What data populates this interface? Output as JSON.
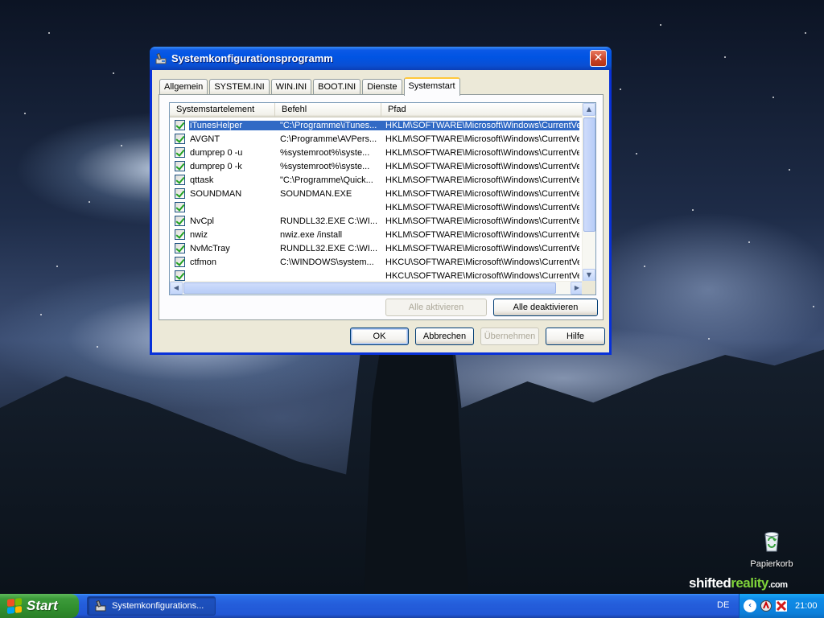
{
  "window": {
    "title": "Systemkonfigurationsprogramm",
    "close_label": "✕",
    "tabs": [
      {
        "label": "Allgemein"
      },
      {
        "label": "SYSTEM.INI"
      },
      {
        "label": "WIN.INI"
      },
      {
        "label": "BOOT.INI"
      },
      {
        "label": "Dienste"
      },
      {
        "label": "Systemstart",
        "active": true
      }
    ],
    "list": {
      "columns": [
        "Systemstartelement",
        "Befehl",
        "Pfad"
      ],
      "rows": [
        {
          "element": "iTunesHelper",
          "command": "\"C:\\Programme\\iTunes...",
          "path": "HKLM\\SOFTWARE\\Microsoft\\Windows\\CurrentVer...",
          "checked": true,
          "selected": true
        },
        {
          "element": "AVGNT",
          "command": "C:\\Programme\\AVPers...",
          "path": "HKLM\\SOFTWARE\\Microsoft\\Windows\\CurrentVer...",
          "checked": true
        },
        {
          "element": "dumprep 0 -u",
          "command": "%systemroot%\\syste...",
          "path": "HKLM\\SOFTWARE\\Microsoft\\Windows\\CurrentVer...",
          "checked": true
        },
        {
          "element": "dumprep 0 -k",
          "command": "%systemroot%\\syste...",
          "path": "HKLM\\SOFTWARE\\Microsoft\\Windows\\CurrentVer...",
          "checked": true
        },
        {
          "element": "qttask",
          "command": "\"C:\\Programme\\Quick...",
          "path": "HKLM\\SOFTWARE\\Microsoft\\Windows\\CurrentVer...",
          "checked": true
        },
        {
          "element": "SOUNDMAN",
          "command": "SOUNDMAN.EXE",
          "path": "HKLM\\SOFTWARE\\Microsoft\\Windows\\CurrentVer...",
          "checked": true
        },
        {
          "element": "",
          "command": "",
          "path": "HKLM\\SOFTWARE\\Microsoft\\Windows\\CurrentVer...",
          "checked": true
        },
        {
          "element": "NvCpl",
          "command": "RUNDLL32.EXE C:\\WI...",
          "path": "HKLM\\SOFTWARE\\Microsoft\\Windows\\CurrentVer...",
          "checked": true
        },
        {
          "element": "nwiz",
          "command": "nwiz.exe /install",
          "path": "HKLM\\SOFTWARE\\Microsoft\\Windows\\CurrentVer...",
          "checked": true
        },
        {
          "element": "NvMcTray",
          "command": "RUNDLL32.EXE C:\\WI...",
          "path": "HKLM\\SOFTWARE\\Microsoft\\Windows\\CurrentVer...",
          "checked": true
        },
        {
          "element": "ctfmon",
          "command": "C:\\WINDOWS\\system...",
          "path": "HKCU\\SOFTWARE\\Microsoft\\Windows\\CurrentVer...",
          "checked": true
        },
        {
          "element": "",
          "command": "",
          "path": "HKCU\\SOFTWARE\\Microsoft\\Windows\\CurrentVer...",
          "checked": true
        }
      ]
    },
    "buttons": {
      "enable_all": "Alle aktivieren",
      "disable_all": "Alle deaktivieren",
      "ok": "OK",
      "cancel": "Abbrechen",
      "apply": "Übernehmen",
      "help": "Hilfe"
    }
  },
  "desktop": {
    "recycle_bin_label": "Papierkorb",
    "watermark": {
      "part1": "shifted",
      "part2": "reality",
      "part3": ".com"
    }
  },
  "taskbar": {
    "start_label": "Start",
    "task_label": "Systemkonfigurations...",
    "language": "DE",
    "clock": "21:00"
  },
  "colors": {
    "selection": "#316ac5",
    "titlebar": "#0054e3",
    "start_button": "#3c9b3a",
    "tray": "#0f8de8"
  }
}
